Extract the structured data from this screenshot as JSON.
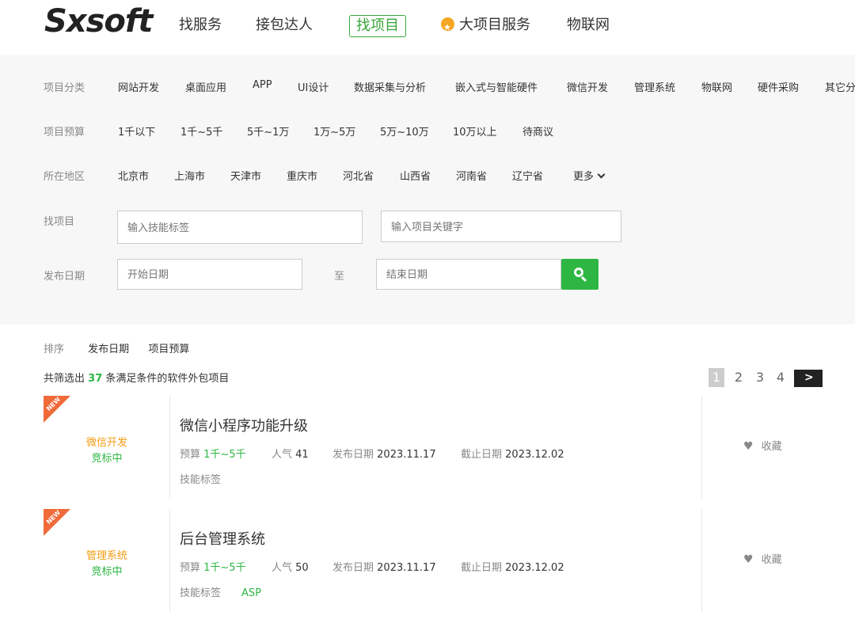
{
  "brand": {
    "logo_text": "Sxsoft"
  },
  "nav": {
    "items": [
      {
        "label": "找服务"
      },
      {
        "label": "接包达人"
      },
      {
        "label": "找项目",
        "active": true
      },
      {
        "label": "大项目服务",
        "icon": "star-badge-icon"
      },
      {
        "label": "物联网"
      }
    ]
  },
  "filter": {
    "category": {
      "label": "项目分类",
      "options": [
        "网站开发",
        "桌面应用",
        "APP",
        "UI设计",
        "数据采集与分析",
        "嵌入式与智能硬件",
        "微信开发",
        "管理系统",
        "物联网",
        "硬件采购",
        "其它分"
      ]
    },
    "budget": {
      "label": "项目预算",
      "options": [
        "1千以下",
        "1千~5千",
        "5千~1万",
        "1万~5万",
        "5万~10万",
        "10万以上",
        "待商议"
      ]
    },
    "region": {
      "label": "所在地区",
      "options": [
        "北京市",
        "上海市",
        "天津市",
        "重庆市",
        "河北省",
        "山西省",
        "河南省",
        "辽宁省"
      ],
      "more": "更多"
    },
    "search": {
      "label": "找项目",
      "skill_placeholder": "输入技能标签",
      "keyword_placeholder": "输入项目关键字"
    },
    "date": {
      "label": "发布日期",
      "start_placeholder": "开始日期",
      "to": "至",
      "end_placeholder": "结束日期"
    }
  },
  "sort": {
    "label": "排序",
    "options": [
      "发布日期",
      "项目预算"
    ]
  },
  "result": {
    "prefix": "共筛选出",
    "count": "37",
    "suffix": "条满足条件的软件外包项目"
  },
  "pager": {
    "pages": [
      "1",
      "2",
      "3",
      "4"
    ],
    "current": "1",
    "next": ">"
  },
  "projects": [
    {
      "badge": "NEW",
      "category": "微信开发",
      "status": "竞标中",
      "title": "微信小程序功能升级",
      "budget_label": "预算",
      "budget": "1千~5千",
      "popularity_label": "人气",
      "popularity": "41",
      "publish_label": "发布日期",
      "publish_date": "2023.11.17",
      "deadline_label": "截止日期",
      "deadline": "2023.12.02",
      "tags_label": "技能标签",
      "tags": "",
      "fav": "收藏"
    },
    {
      "badge": "NEW",
      "category": "管理系统",
      "status": "竞标中",
      "title": "后台管理系统",
      "budget_label": "预算",
      "budget": "1千~5千",
      "popularity_label": "人气",
      "popularity": "50",
      "publish_label": "发布日期",
      "publish_date": "2023.11.17",
      "deadline_label": "截止日期",
      "deadline": "2023.12.02",
      "tags_label": "技能标签",
      "tags": "ASP",
      "fav": "收藏"
    }
  ],
  "colors": {
    "accent_green": "#2db742",
    "orange": "#f39c12",
    "ribbon": "#f06a3a"
  }
}
